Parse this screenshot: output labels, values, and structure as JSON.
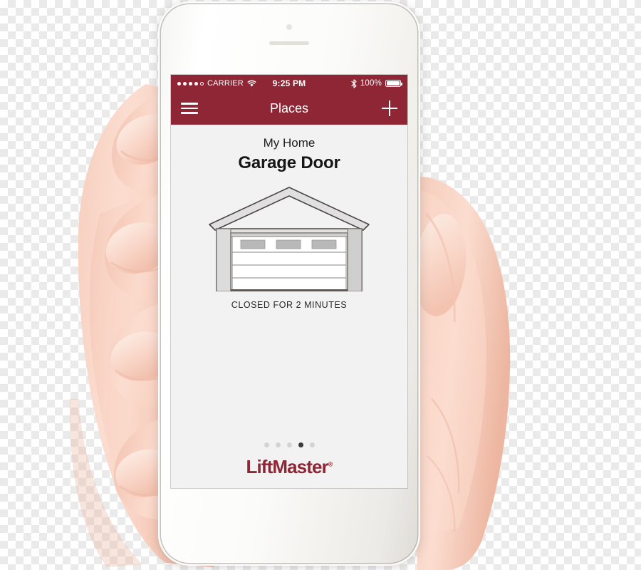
{
  "status_bar": {
    "signal_dots_total": 5,
    "signal_dots_filled": 4,
    "carrier": "CARRIER",
    "wifi_icon": "wifi-icon",
    "time": "9:25 PM",
    "bluetooth_icon": "bluetooth-icon",
    "battery_percent": "100%",
    "battery_level": 100
  },
  "nav_bar": {
    "menu_icon": "hamburger-menu-icon",
    "title": "Places",
    "add_icon": "plus-icon"
  },
  "content": {
    "place_name": "My Home",
    "device_name": "Garage Door",
    "door_illustration": "garage-door-closed-illustration",
    "status_text": "CLOSED FOR 2 MINUTES"
  },
  "footer": {
    "page_dots_total": 5,
    "page_dots_active_index": 3,
    "brand": "LiftMaster",
    "brand_trademark": "®"
  },
  "colors": {
    "brand_red": "#8e2636",
    "screen_bg": "#f2f2f2",
    "status_text": "#272727",
    "dot_inactive": "#d4d4d4",
    "dot_active": "#3a3a3a"
  }
}
